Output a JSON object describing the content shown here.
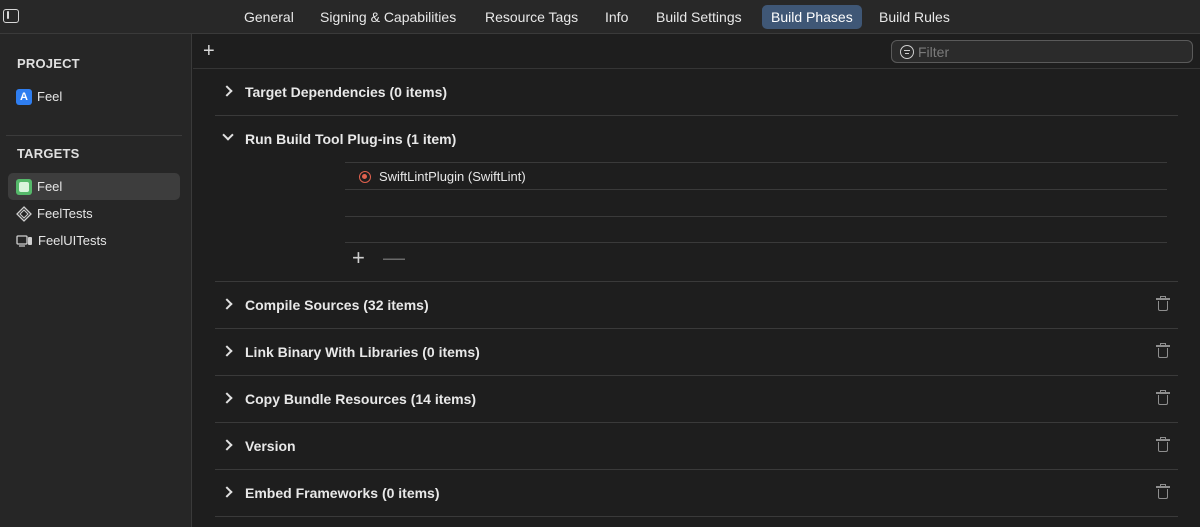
{
  "tabs": [
    {
      "label": "General",
      "active": false
    },
    {
      "label": "Signing & Capabilities",
      "active": false
    },
    {
      "label": "Resource Tags",
      "active": false
    },
    {
      "label": "Info",
      "active": false
    },
    {
      "label": "Build Settings",
      "active": false
    },
    {
      "label": "Build Phases",
      "active": true
    },
    {
      "label": "Build Rules",
      "active": false
    }
  ],
  "sidebar": {
    "project_header": "PROJECT",
    "project_items": [
      {
        "label": "Feel",
        "icon": "app-icon"
      }
    ],
    "targets_header": "TARGETS",
    "target_items": [
      {
        "label": "Feel",
        "icon": "app-target-icon",
        "selected": true
      },
      {
        "label": "FeelTests",
        "icon": "test-bundle-icon",
        "selected": false
      },
      {
        "label": "FeelUITests",
        "icon": "ui-test-bundle-icon",
        "selected": false
      }
    ]
  },
  "toolbar": {
    "add_label": "+",
    "filter_placeholder": "Filter"
  },
  "phases": [
    {
      "title": "Target Dependencies (0 items)",
      "expanded": false,
      "deletable": false
    },
    {
      "title": "Run Build Tool Plug-ins (1 item)",
      "expanded": true,
      "deletable": false,
      "items": [
        {
          "label": "SwiftLintPlugin (SwiftLint)",
          "icon": "plugin-target-icon"
        }
      ]
    },
    {
      "title": "Compile Sources (32 items)",
      "expanded": false,
      "deletable": true
    },
    {
      "title": "Link Binary With Libraries (0 items)",
      "expanded": false,
      "deletable": true
    },
    {
      "title": "Copy Bundle Resources (14 items)",
      "expanded": false,
      "deletable": true
    },
    {
      "title": "Version",
      "expanded": false,
      "deletable": true
    },
    {
      "title": "Embed Frameworks (0 items)",
      "expanded": false,
      "deletable": true
    }
  ],
  "plugin_controls": {
    "add": "+",
    "remove": "—"
  },
  "colors": {
    "accent_tab": "#3f5776",
    "plugin_icon": "#e0614e",
    "app_icon": "#2f7ef0",
    "target_icon": "#55b96a"
  }
}
